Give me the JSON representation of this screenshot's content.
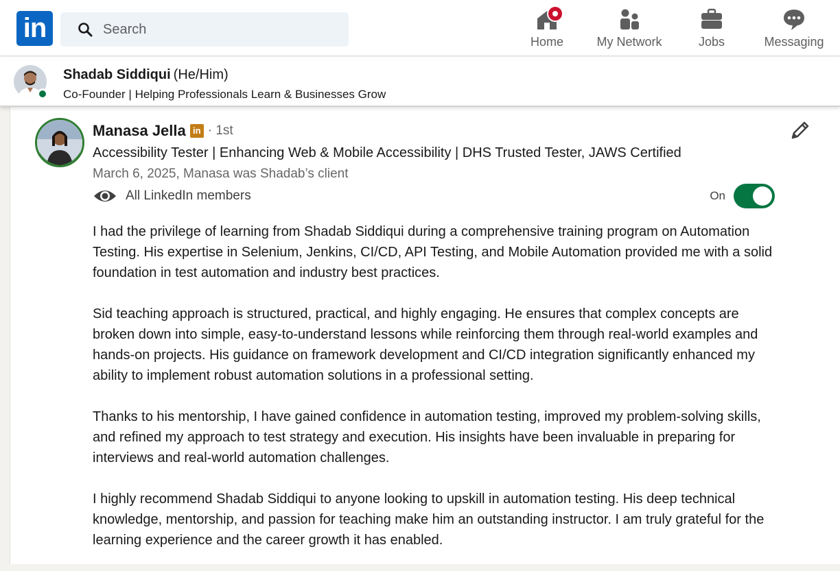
{
  "nav": {
    "logo_text": "in",
    "search_placeholder": "Search",
    "items": [
      {
        "label": "Home",
        "icon": "home-icon",
        "badge": true
      },
      {
        "label": "My Network",
        "icon": "network-icon"
      },
      {
        "label": "Jobs",
        "icon": "briefcase-icon"
      },
      {
        "label": "Messaging",
        "icon": "messaging-icon"
      }
    ]
  },
  "profile": {
    "name": "Shadab Siddiqui",
    "pronouns": "(He/Him)",
    "headline": "Co-Founder | Helping Professionals Learn & Businesses Grow",
    "online": true
  },
  "recommendation": {
    "name": "Manasa Jella",
    "badge_text": "in",
    "degree": "· 1st",
    "headline": "Accessibility Tester | Enhancing Web & Mobile Accessibility | DHS Trusted Tester, JAWS Certified",
    "date_relation": "March 6, 2025, Manasa was Shadab’s client",
    "visibility": "All LinkedIn members",
    "toggle_label": "On",
    "toggle_on": true,
    "paragraphs": [
      "I had the privilege of learning from Shadab Siddiqui during a comprehensive training program on Automation Testing. His expertise in Selenium, Jenkins, CI/CD, API Testing, and Mobile Automation provided me with a solid foundation in test automation and industry best practices.",
      "Sid teaching approach is structured, practical, and highly engaging. He ensures that complex concepts are broken down into simple, easy-to-understand lessons while reinforcing them through real-world examples and hands-on projects. His guidance on framework development and CI/CD integration significantly enhanced my ability to implement robust automation solutions in a professional setting.",
      "Thanks to his mentorship, I have gained confidence in automation testing, improved my problem-solving skills, and refined my approach to test strategy and execution. His insights have been invaluable in preparing for interviews and real-world automation challenges.",
      "I highly recommend Shadab Siddiqui to anyone looking to upskill in automation testing. His deep technical knowledge, mentorship, and passion for teaching make him an outstanding instructor. I am truly grateful for the learning experience and the career growth it has enabled."
    ]
  },
  "colors": {
    "brand": "#0a66c2",
    "toggle_on": "#057642",
    "badge_red": "#cb112d",
    "premium_gold": "#c37d16"
  }
}
